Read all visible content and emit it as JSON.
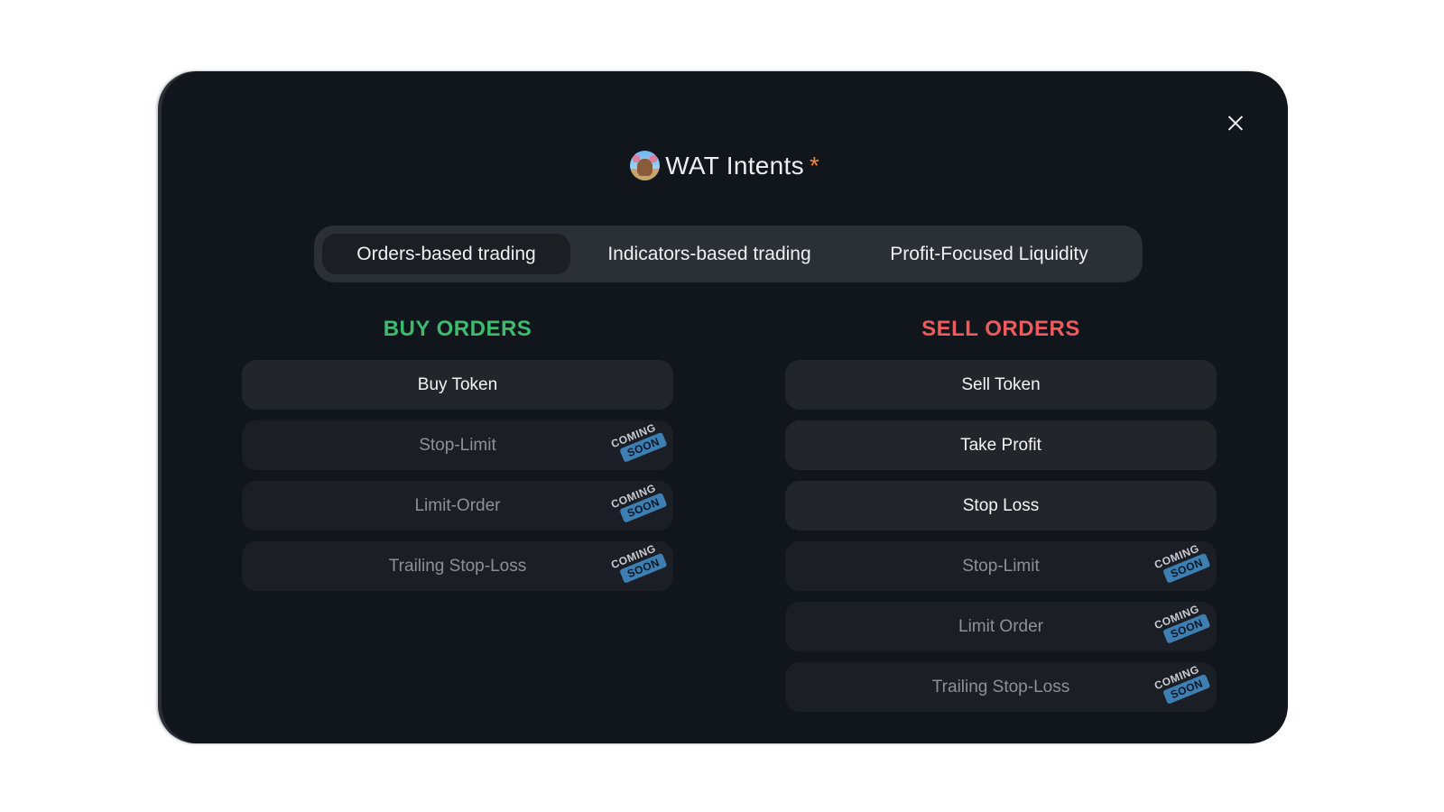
{
  "modal": {
    "title": "WAT Intents",
    "title_mark": "*",
    "close_icon": "close-icon"
  },
  "tabs": [
    {
      "label": "Orders-based trading",
      "active": true
    },
    {
      "label": "Indicators-based trading",
      "active": false
    },
    {
      "label": "Profit-Focused Liquidity",
      "active": false
    }
  ],
  "colors": {
    "buy": "#3dbb70",
    "sell": "#ee5a5d",
    "badge": "#3d7fb3",
    "accent": "#f0883e"
  },
  "badge": {
    "line1": "COMING",
    "line2": "SOON"
  },
  "buy": {
    "heading": "BUY ORDERS",
    "items": [
      {
        "label": "Buy Token",
        "coming_soon": false
      },
      {
        "label": "Stop-Limit",
        "coming_soon": true
      },
      {
        "label": "Limit-Order",
        "coming_soon": true
      },
      {
        "label": "Trailing Stop-Loss",
        "coming_soon": true
      }
    ]
  },
  "sell": {
    "heading": "SELL ORDERS",
    "items": [
      {
        "label": "Sell Token",
        "coming_soon": false
      },
      {
        "label": "Take Profit",
        "coming_soon": false
      },
      {
        "label": "Stop Loss",
        "coming_soon": false
      },
      {
        "label": "Stop-Limit",
        "coming_soon": true
      },
      {
        "label": "Limit Order",
        "coming_soon": true
      },
      {
        "label": "Trailing Stop-Loss",
        "coming_soon": true
      }
    ]
  }
}
